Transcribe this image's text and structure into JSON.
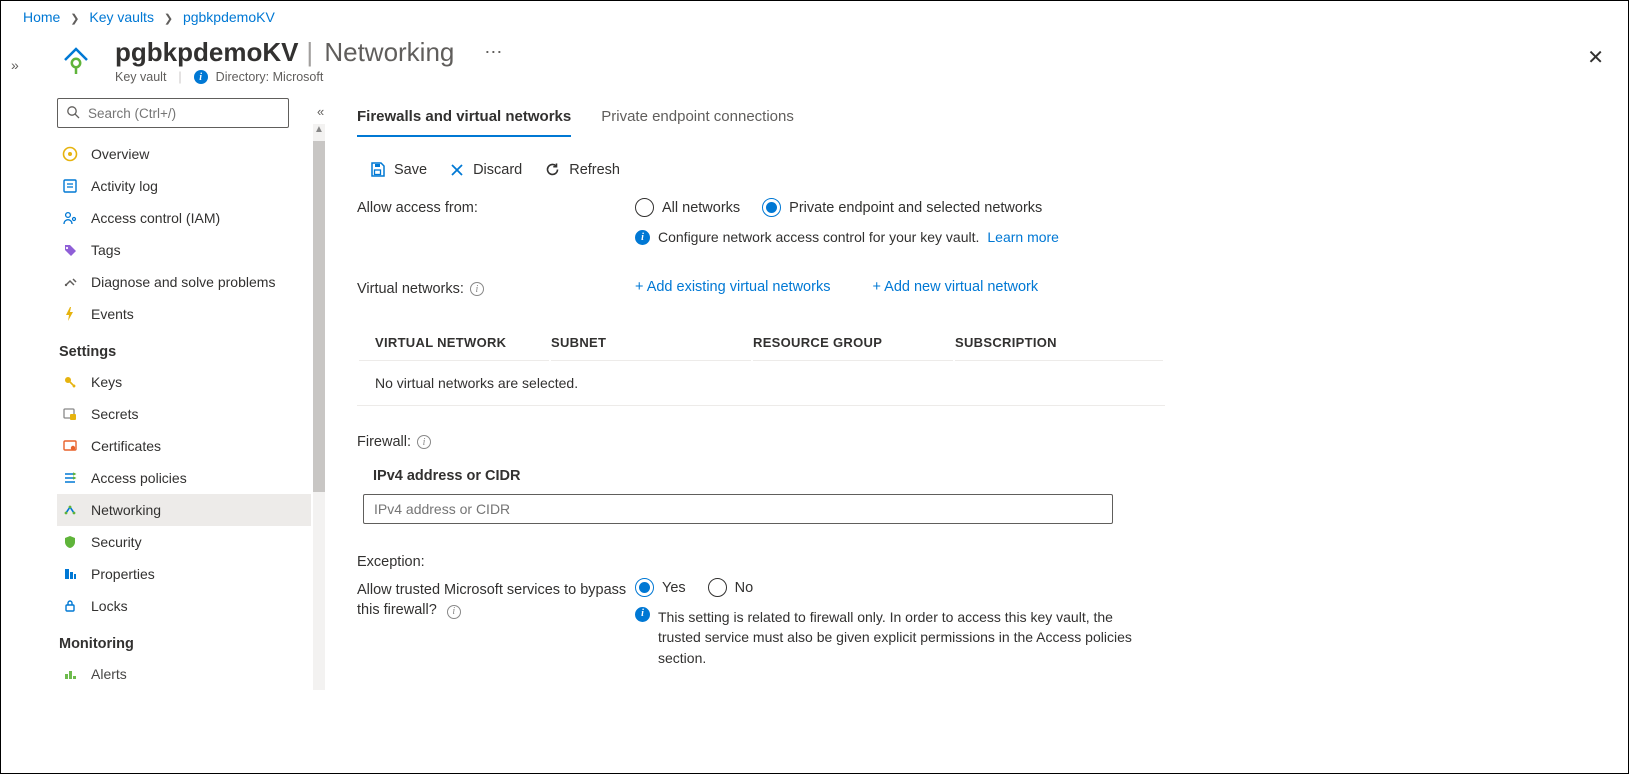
{
  "breadcrumb": {
    "items": [
      "Home",
      "Key vaults",
      "pgbkpdemoKV"
    ]
  },
  "header": {
    "title": "pgbkpdemoKV",
    "section": "Networking",
    "resourceType": "Key vault",
    "directoryLabel": "Directory: Microsoft"
  },
  "sidebar": {
    "searchPlaceholder": "Search (Ctrl+/)",
    "groups": {
      "core": {
        "overview": "Overview",
        "activityLog": "Activity log",
        "accessControl": "Access control (IAM)",
        "tags": "Tags",
        "diagnose": "Diagnose and solve problems",
        "events": "Events"
      },
      "settingsHeader": "Settings",
      "settings": {
        "keys": "Keys",
        "secrets": "Secrets",
        "certificates": "Certificates",
        "accessPolicies": "Access policies",
        "networking": "Networking",
        "security": "Security",
        "properties": "Properties",
        "locks": "Locks"
      },
      "monitoringHeader": "Monitoring",
      "monitoring": {
        "alerts": "Alerts"
      }
    }
  },
  "tabs": {
    "firewalls": "Firewalls and virtual networks",
    "private": "Private endpoint connections"
  },
  "toolbar": {
    "save": "Save",
    "discard": "Discard",
    "refresh": "Refresh"
  },
  "access": {
    "label": "Allow access from:",
    "optionAll": "All networks",
    "optionPrivate": "Private endpoint and selected networks",
    "info": "Configure network access control for your key vault.",
    "learnMore": "Learn more"
  },
  "vnets": {
    "label": "Virtual networks:",
    "addExisting": "+ Add existing virtual networks",
    "addNew": "+ Add new virtual network",
    "headers": {
      "c1": "VIRTUAL NETWORK",
      "c2": "SUBNET",
      "c3": "RESOURCE GROUP",
      "c4": "SUBSCRIPTION"
    },
    "emptyMessage": "No virtual networks are selected."
  },
  "firewall": {
    "label": "Firewall:",
    "ipHeader": "IPv4 address or CIDR",
    "placeholder": "IPv4 address or CIDR"
  },
  "exception": {
    "label": "Exception:",
    "bypassLabel": "Allow trusted Microsoft services to bypass this firewall?",
    "yes": "Yes",
    "no": "No",
    "note": "This setting is related to firewall only. In order to access this key vault, the trusted service must also be given explicit permissions in the Access policies section."
  }
}
